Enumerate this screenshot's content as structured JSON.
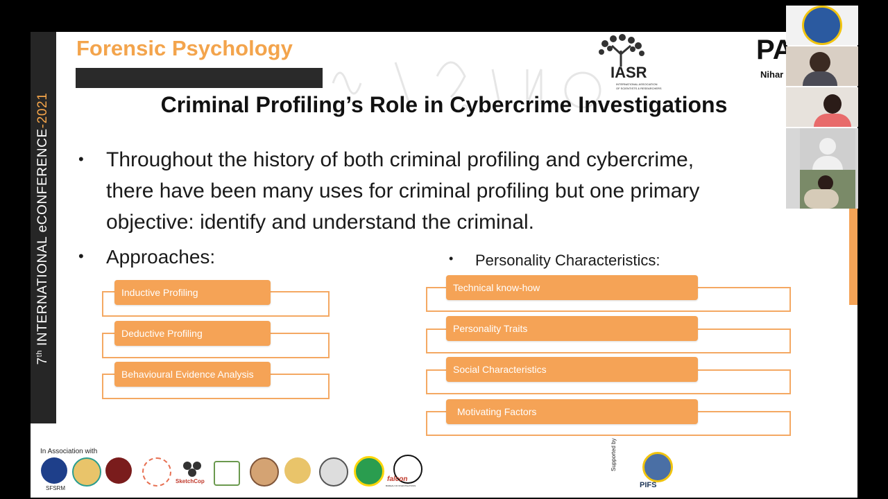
{
  "colors": {
    "accent": "#f5a356",
    "dark": "#262626"
  },
  "sidebar": {
    "pre": "7",
    "sup": "th",
    "mid": " INTERNATIONAL e",
    "conf": "CONFERENCE",
    "year": "-2021"
  },
  "brand": {
    "title": "Forensic Psychology",
    "org_short": "IASR",
    "org_full_line1": "INTERNATIONAL ASSOCIATION",
    "org_full_line2": "OF SCIENTISTS & RESEARCHERS",
    "partial_logo": "PA",
    "partial_name": "Nihar"
  },
  "heading": "Criminal Profiling’s Role in Cybercrime Investigations",
  "bullet_main": {
    "line1": "Throughout the history of both criminal profiling and cybercrime,",
    "line2": "there have been many uses for criminal profiling but one primary",
    "line3": "objective: identify and understand the criminal."
  },
  "approaches": {
    "label": "Approaches:",
    "items": [
      "Inductive Profiling",
      "Deductive Profiling",
      "Behavioural Evidence Analysis"
    ]
  },
  "personality": {
    "label": "Personality Characteristics:",
    "items": [
      "Technical know-how",
      "Personality Traits",
      "Social Characteristics",
      "Motivating Factors"
    ]
  },
  "footer": {
    "association_label": "In Association with",
    "sfsrm": "SFSRM",
    "sketchcop": "SketchCop",
    "falcon": "falcon",
    "falcon_sub": "BUREAU OF INVESTIGATIONS",
    "supported_by": "Supported by",
    "supporter": "PIFS"
  },
  "icons": {
    "bullet": "•"
  }
}
